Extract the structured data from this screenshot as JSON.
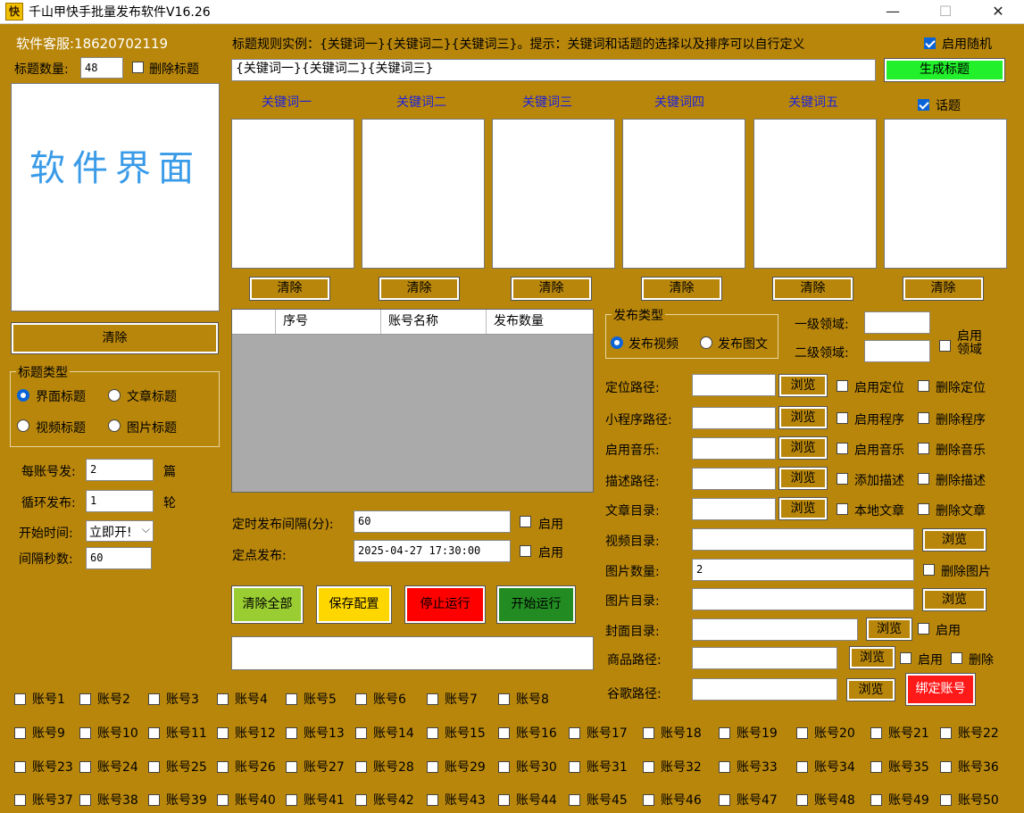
{
  "window": {
    "icon_glyph": "快",
    "title": "千山甲快手批量发布软件V16.26",
    "minimize_glyph": "—",
    "maximize_glyph": "☐",
    "close_glyph": "✕"
  },
  "left": {
    "service_label": "软件客服:18620702119",
    "title_count_label": "标题数量:",
    "title_count_value": "48",
    "delete_title_label": "删除标题",
    "preview_text": "软件界面",
    "clear_button": "清除",
    "title_type_group": "标题类型",
    "title_types": [
      "界面标题",
      "文章标题",
      "视频标题",
      "图片标题"
    ],
    "per_account_label": "每账号发:",
    "per_account_value": "2",
    "per_account_unit": "篇",
    "loop_label": "循环发布:",
    "loop_value": "1",
    "loop_unit": "轮",
    "start_time_label": "开始时间:",
    "start_time_value": "立即开!",
    "interval_sec_label": "间隔秒数:",
    "interval_sec_value": "60"
  },
  "top": {
    "rule_hint": "标题规则实例：{关键词一}{关键词二}{关键词三}。提示：关键词和话题的选择以及排序可以自行定义",
    "enable_random_label": "启用随机",
    "rule_input_value": "{关键词一}{关键词二}{关键词三}",
    "generate_button": "生成标题",
    "keywords": [
      "关键词一",
      "关键词二",
      "关键词三",
      "关键词四",
      "关键词五"
    ],
    "topic_label": "话题",
    "clear_label": "清除"
  },
  "grid": {
    "columns": [
      "",
      "序号",
      "账号名称",
      "发布数量"
    ]
  },
  "schedule": {
    "timed_interval_label": "定时发布间隔(分):",
    "timed_interval_value": "60",
    "timed_enable_label": "启用",
    "fixed_label": "定点发布:",
    "fixed_value": "2025-04-27 17:30:00",
    "fixed_enable_label": "启用"
  },
  "actions": {
    "clear_all": "清除全部",
    "save_config": "保存配置",
    "stop": "停止运行",
    "start": "开始运行"
  },
  "publish": {
    "type_group": "发布类型",
    "type_video": "发布视频",
    "type_image": "发布图文",
    "level1_label": "一级领域:",
    "level2_label": "二级领域:",
    "enable_domain_label_1": "启用",
    "enable_domain_label_2": "领域",
    "browse": "浏览",
    "location_label": "定位路径:",
    "location_enable": "启用定位",
    "location_delete": "删除定位",
    "miniapp_label": "小程序路径:",
    "miniapp_enable": "启用程序",
    "miniapp_delete": "删除程序",
    "music_label": "启用音乐:",
    "music_enable": "启用音乐",
    "music_delete": "删除音乐",
    "desc_label": "描述路径:",
    "desc_enable": "添加描述",
    "desc_delete": "删除描述",
    "article_label": "文章目录:",
    "article_enable": "本地文章",
    "article_delete": "删除文章",
    "video_dir_label": "视频目录:",
    "image_count_label": "图片数量:",
    "image_count_value": "2",
    "image_delete": "删除图片",
    "image_dir_label": "图片目录:",
    "cover_dir_label": "封面目录:",
    "cover_enable": "启用",
    "product_label": "商品路径:",
    "product_enable": "启用",
    "product_delete": "删除",
    "google_label": "谷歌路径:",
    "bind_account": "绑定账号"
  },
  "accounts": [
    "账号1",
    "账号2",
    "账号3",
    "账号4",
    "账号5",
    "账号6",
    "账号7",
    "账号8",
    "账号9",
    "账号10",
    "账号11",
    "账号12",
    "账号13",
    "账号14",
    "账号15",
    "账号16",
    "账号17",
    "账号18",
    "账号19",
    "账号20",
    "账号21",
    "账号22",
    "账号23",
    "账号24",
    "账号25",
    "账号26",
    "账号27",
    "账号28",
    "账号29",
    "账号30",
    "账号31",
    "账号32",
    "账号33",
    "账号34",
    "账号35",
    "账号36",
    "账号37",
    "账号38",
    "账号39",
    "账号40",
    "账号41",
    "账号42",
    "账号43",
    "账号44",
    "账号45",
    "账号46",
    "账号47",
    "账号48",
    "账号49",
    "账号50"
  ],
  "colors": {
    "background": "#b8860b",
    "generate_button": "#21f02a",
    "preview_text": "#3a9be8",
    "keyword_header": "#1e22d8",
    "clear_all_button": "#9acd32",
    "save_button": "#ffd700",
    "stop_button": "#ff0000",
    "start_button": "#228b22",
    "bind_button": "#ff1a1a",
    "checkbox_on": "#0a64d8"
  }
}
